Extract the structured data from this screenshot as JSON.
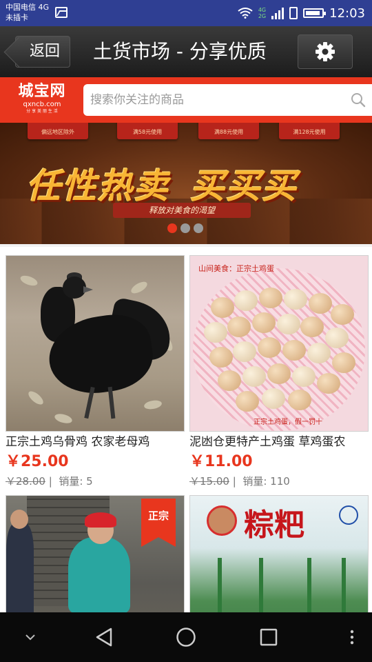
{
  "status_bar": {
    "carrier_line1": "中国电信 4G",
    "carrier_line2": "未插卡",
    "network_top": "4G",
    "network_bottom": "2G",
    "time": "12:03",
    "icons": [
      "image-icon",
      "wifi-icon",
      "signal-icon",
      "sim-icon",
      "battery-icon"
    ]
  },
  "header": {
    "back_label": "返回",
    "title": "土货市场 - 分享优质",
    "settings_icon": "gear-icon"
  },
  "search": {
    "logo_text": "城宝网",
    "logo_domain": "qxncb.com",
    "logo_tagline": "分 享 美 丽 生 活",
    "placeholder": "搜索你关注的商品",
    "icon": "search-icon"
  },
  "banner": {
    "coupons": [
      "偏远地区除外",
      "满58元使用",
      "满88元使用",
      "满128元使用"
    ],
    "headline_part1": "任性热卖",
    "headline_part2": "买买买",
    "subline": "释放对美食的渴望",
    "page_count": 3,
    "active_page": 1
  },
  "products": [
    {
      "name": "正宗土鸡乌骨鸡 农家老母鸡",
      "price": "￥25.00",
      "original_price": "￥28.00",
      "separator": "|",
      "sales_label": "销量: 5"
    },
    {
      "name": "泥凼仓更特产土鸡蛋 草鸡蛋农",
      "price": "￥11.00",
      "original_price": "￥15.00",
      "separator": "|",
      "sales_label": "销量: 110",
      "image_caption_top": "山间美食：正宗土鸡蛋",
      "image_caption_bottom": "正宗土鸡蛋，假一罚十"
    },
    {
      "name": "",
      "badge": "正宗"
    },
    {
      "name": "",
      "image_text": "粽粑"
    }
  ],
  "nav_bar": {
    "icons": [
      "chevron-down-icon",
      "back-triangle-icon",
      "home-circle-icon",
      "recents-square-icon",
      "more-dots-icon"
    ]
  },
  "colors": {
    "status_bar": "#2f3f93",
    "accent_red": "#e8361e",
    "title_bar": "#1c1c1c",
    "price_red": "#e8361e"
  }
}
